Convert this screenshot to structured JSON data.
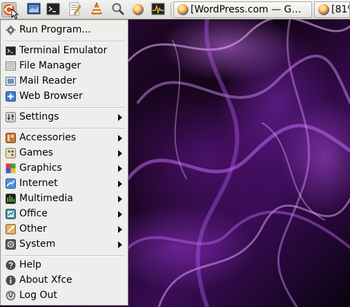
{
  "panel": {
    "launchers": [
      {
        "name": "xfce-menu-icon"
      },
      {
        "name": "desktop-icon"
      },
      {
        "name": "terminal-icon"
      },
      {
        "name": "text-editor-icon"
      },
      {
        "name": "media-player-icon"
      },
      {
        "name": "search-icon"
      },
      {
        "name": "firefox-icon"
      },
      {
        "name": "system-monitor-icon"
      }
    ],
    "tasks": [
      {
        "label": "[WordPress.com — G…"
      },
      {
        "label": "[81%"
      }
    ]
  },
  "menu": {
    "items": [
      {
        "label": "Run Program...",
        "icon": "gear-icon",
        "submenu": false
      },
      {
        "label": "Terminal Emulator",
        "icon": "terminal-icon",
        "submenu": false
      },
      {
        "label": "File Manager",
        "icon": "file-manager-icon",
        "submenu": false
      },
      {
        "label": "Mail Reader",
        "icon": "mail-icon",
        "submenu": false
      },
      {
        "label": "Web Browser",
        "icon": "web-browser-icon",
        "submenu": false
      },
      {
        "label": "Settings",
        "icon": "settings-icon",
        "submenu": true
      },
      {
        "label": "Accessories",
        "icon": "accessories-icon",
        "submenu": true
      },
      {
        "label": "Games",
        "icon": "games-icon",
        "submenu": true
      },
      {
        "label": "Graphics",
        "icon": "graphics-icon",
        "submenu": true
      },
      {
        "label": "Internet",
        "icon": "internet-icon",
        "submenu": true
      },
      {
        "label": "Multimedia",
        "icon": "multimedia-icon",
        "submenu": true
      },
      {
        "label": "Office",
        "icon": "office-icon",
        "submenu": true
      },
      {
        "label": "Other",
        "icon": "other-icon",
        "submenu": true
      },
      {
        "label": "System",
        "icon": "system-icon",
        "submenu": true
      },
      {
        "label": "Help",
        "icon": "help-icon",
        "submenu": false
      },
      {
        "label": "About Xfce",
        "icon": "info-icon",
        "submenu": false
      },
      {
        "label": "Log Out",
        "icon": "log-out-icon",
        "submenu": false
      }
    ]
  },
  "colors": {
    "wallpaper_accent": "#b060e0",
    "menu_background": "#eeeeec"
  }
}
